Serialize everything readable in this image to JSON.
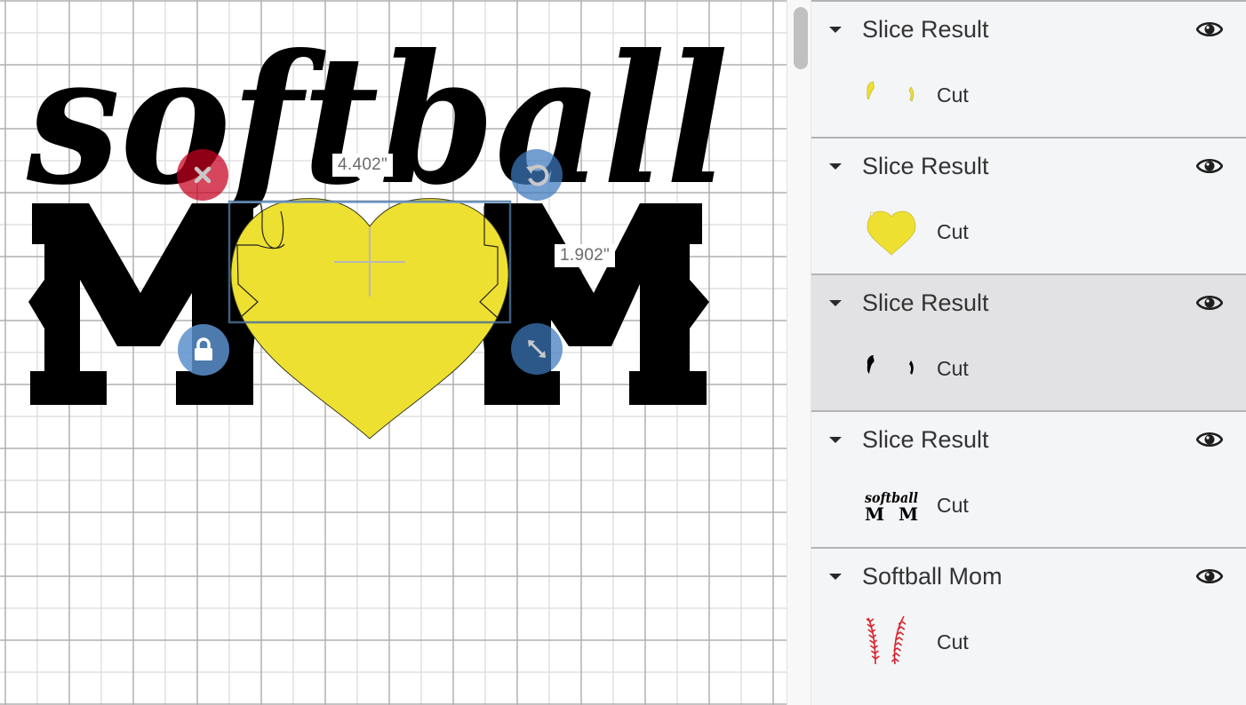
{
  "canvas": {
    "design_text_script": "softball",
    "design_text_block": "M  M",
    "dimension_width": "4.402\"",
    "dimension_height": "1.902\"",
    "handles": {
      "delete": "close-icon",
      "rotate": "rotate-icon",
      "lock": "lock-icon",
      "resize": "resize-icon"
    },
    "colors": {
      "heart_fill": "#EEE030",
      "letters": "#000000",
      "selection_box": "#4A6E96",
      "delete_handle": "#C6001E",
      "blue_handle": "#3C78BE"
    }
  },
  "layers_panel": {
    "groups": [
      {
        "title": "Slice Result",
        "visible": true,
        "selected": false,
        "thumbnail": "yellow-slice-fragments",
        "items": [
          {
            "label": "Cut"
          }
        ]
      },
      {
        "title": "Slice Result",
        "visible": true,
        "selected": false,
        "thumbnail": "yellow-heart",
        "items": [
          {
            "label": "Cut"
          }
        ]
      },
      {
        "title": "Slice Result",
        "visible": true,
        "selected": true,
        "thumbnail": "black-slice-fragments",
        "items": [
          {
            "label": "Cut"
          }
        ]
      },
      {
        "title": "Slice Result",
        "visible": true,
        "selected": false,
        "thumbnail": "softball-mom-text",
        "items": [
          {
            "label": "Cut"
          }
        ]
      },
      {
        "title": "Softball Mom",
        "visible": true,
        "selected": false,
        "thumbnail": "red-stitches",
        "items": [
          {
            "label": "Cut"
          }
        ]
      }
    ],
    "thumb_text": {
      "script": "softball",
      "block": "M  M"
    }
  }
}
